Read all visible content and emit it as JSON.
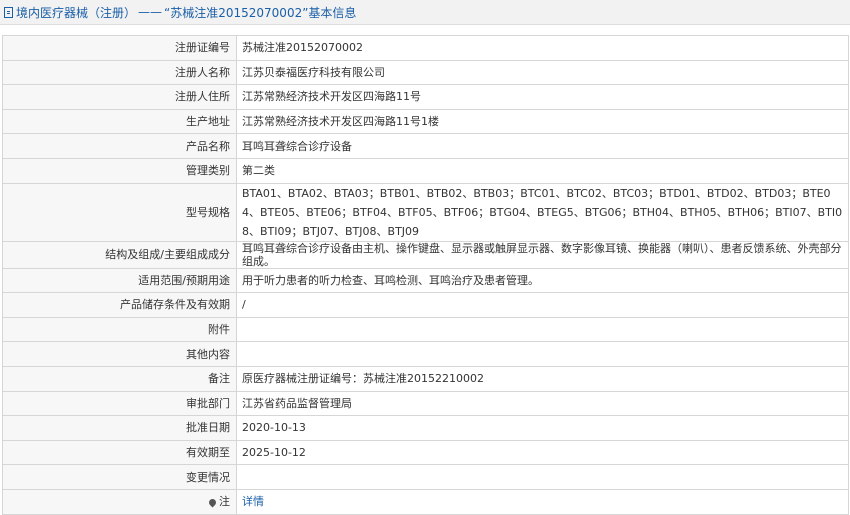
{
  "header": {
    "breadcrumb": "境内医疗器械（注册）",
    "separator": "——",
    "title": "“苏械注准20152070002”基本信息"
  },
  "rows": [
    {
      "label": "注册证编号",
      "value": "苏械注准20152070002"
    },
    {
      "label": "注册人名称",
      "value": "江苏贝泰福医疗科技有限公司"
    },
    {
      "label": "注册人住所",
      "value": "江苏常熟经济技术开发区四海路11号"
    },
    {
      "label": "生产地址",
      "value": "江苏常熟经济技术开发区四海路11号1楼"
    },
    {
      "label": "产品名称",
      "value": "耳鸣耳聋综合诊疗设备"
    },
    {
      "label": "管理类别",
      "value": "第二类"
    },
    {
      "label": "型号规格",
      "value": "BTA01、BTA02、BTA03；BTB01、BTB02、BTB03；BTC01、BTC02、BTC03；BTD01、BTD02、BTD03；BTE04、BTE05、BTE06；BTF04、BTF05、BTF06；BTG04、BTEG5、BTG06；BTH04、BTH05、BTH06；BTI07、BTI08、BTI09；BTJ07、BTJ08、BTJ09"
    },
    {
      "label": "结构及组成/主要组成成分",
      "value": "耳鸣耳聋综合诊疗设备由主机、操作键盘、显示器或触屏显示器、数字影像耳镜、换能器（喇叭）、患者反馈系统、外壳部分组成。"
    },
    {
      "label": "适用范围/预期用途",
      "value": "用于听力患者的听力检查、耳鸣检测、耳鸣治疗及患者管理。"
    },
    {
      "label": "产品储存条件及有效期",
      "value": "/"
    },
    {
      "label": "附件",
      "value": ""
    },
    {
      "label": "其他内容",
      "value": ""
    },
    {
      "label": "备注",
      "value": "原医疗器械注册证编号：苏械注准20152210002"
    },
    {
      "label": "审批部门",
      "value": "江苏省药品监督管理局"
    },
    {
      "label": "批准日期",
      "value": "2020-10-13"
    },
    {
      "label": "有效期至",
      "value": "2025-10-12"
    },
    {
      "label": "变更情况",
      "value": ""
    }
  ],
  "note_row": {
    "label": "注",
    "link": "详情",
    "icon": "map-pin-icon"
  },
  "colors": {
    "link": "#1a5fa8",
    "label_bg": "#f7f7f7",
    "border": "#d6d6d6"
  }
}
